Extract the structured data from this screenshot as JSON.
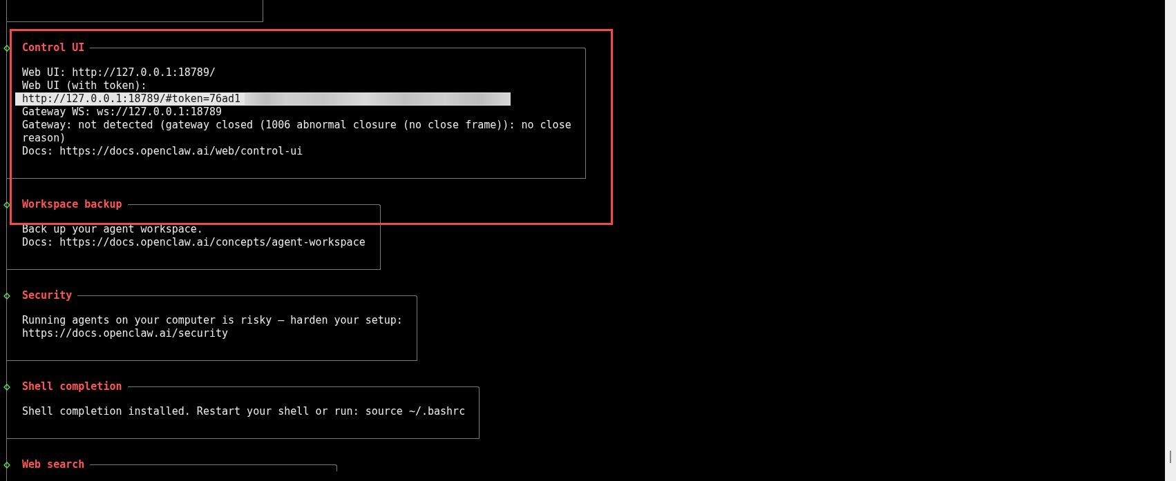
{
  "sections": [
    {
      "title": "Control UI",
      "lines": [
        {
          "kind": "text",
          "text": "Web UI: http://127.0.0.1:18789/"
        },
        {
          "kind": "text",
          "text": "Web UI (with token):"
        },
        {
          "kind": "token",
          "text": "http://127.0.0.1:18789/#token=76ad1",
          "selected": true
        },
        {
          "kind": "text",
          "text": "Gateway WS: ws://127.0.0.1:18789"
        },
        {
          "kind": "text",
          "text": "Gateway: not detected (gateway closed (1006 abnormal closure (no close frame)): no close reason)"
        },
        {
          "kind": "text",
          "text": "Docs: https://docs.openclaw.ai/web/control-ui"
        }
      ]
    },
    {
      "title": "Workspace backup",
      "lines": [
        {
          "kind": "text",
          "text": "Back up your agent workspace."
        },
        {
          "kind": "text",
          "text": "Docs: https://docs.openclaw.ai/concepts/agent-workspace"
        }
      ]
    },
    {
      "title": "Security",
      "lines": [
        {
          "kind": "text",
          "text": "Running agents on your computer is risky — harden your setup:"
        },
        {
          "kind": "text",
          "text": "https://docs.openclaw.ai/security"
        }
      ]
    },
    {
      "title": "Shell completion",
      "lines": [
        {
          "kind": "text",
          "text": "Shell completion installed. Restart your shell or run: source ~/.bashrc"
        }
      ]
    },
    {
      "title": "Web search"
    }
  ]
}
